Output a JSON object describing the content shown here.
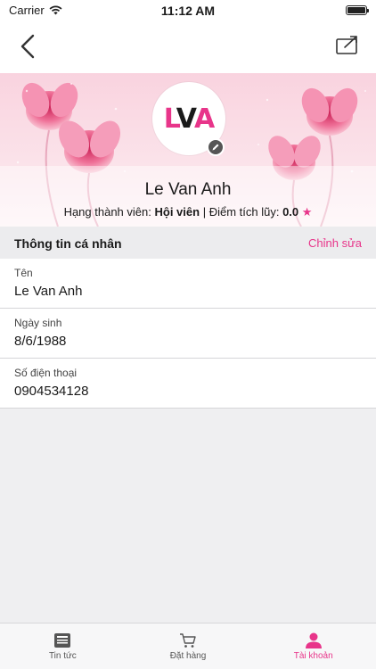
{
  "status_bar": {
    "carrier": "Carrier",
    "time": "11:12 AM"
  },
  "profile": {
    "logo_text_1": "L",
    "logo_text_2": "V",
    "logo_text_3": "A",
    "name": "Le Van Anh",
    "rank_label": "Hạng thành viên:",
    "rank_value": "Hội viên",
    "separator": "|",
    "points_label": "Điểm tích lũy:",
    "points_value": "0.0"
  },
  "section": {
    "title": "Thông tin cá nhân",
    "edit_label": "Chỉnh sửa"
  },
  "fields": [
    {
      "label": "Tên",
      "value": "Le Van Anh"
    },
    {
      "label": "Ngày sinh",
      "value": "8/6/1988"
    },
    {
      "label": "Số điện thoại",
      "value": "0904534128"
    }
  ],
  "tabs": [
    {
      "label": "Tin tức",
      "icon": "newspaper-icon"
    },
    {
      "label": "Đặt hàng",
      "icon": "cart-icon"
    },
    {
      "label": "Tài khoản",
      "icon": "person-icon",
      "active": true
    }
  ],
  "colors": {
    "accent": "#e8358a",
    "banner_pink": "#f9d3df"
  }
}
